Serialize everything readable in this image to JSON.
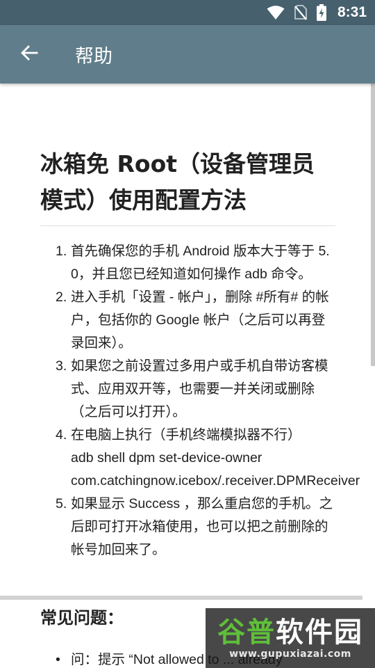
{
  "status_bar": {
    "time": "8:31",
    "icons": [
      "wifi-icon",
      "no-sim-icon",
      "battery-charging-icon"
    ]
  },
  "app_bar": {
    "back_icon": "arrow-left-icon",
    "title": "帮助"
  },
  "article": {
    "title": "冰箱免 Root（设备管理员模式）使用配置方法",
    "steps": [
      {
        "num": "1.",
        "text": "首先确保您的手机 Android 版本大于等于 5.0，并且您已经知道如何操作 adb 命令。"
      },
      {
        "num": "2.",
        "text": "进入手机「设置 - 帐户」，删除 #所有# 的帐户，包括你的 Google 帐户（之后可以再登录回来）。"
      },
      {
        "num": "3.",
        "text": "如果您之前设置过多用户或手机自带访客模式、应用双开等，也需要一并关闭或删除（之后可以打开）。"
      },
      {
        "num": "4.",
        "text": "在电脑上执行（手机终端模拟器不行）",
        "cmd1": "adb shell dpm set-device-owner",
        "cmd2": "com.catchingnow.icebox/.receiver.DPMReceiver"
      },
      {
        "num": "5.",
        "text": "如果显示 Success ，那么重启您的手机。之后即可打开冰箱使用，也可以把之前删除的帐号加回来了。"
      }
    ]
  },
  "faq": {
    "title": "常见问题：",
    "items": [
      {
        "bullet": "•",
        "text": "问：提示 “Not allowed to ... already"
      }
    ]
  },
  "watermark": {
    "brand_a": "谷普",
    "brand_b": "软件园",
    "url": "www.gupuxiazai.com"
  }
}
